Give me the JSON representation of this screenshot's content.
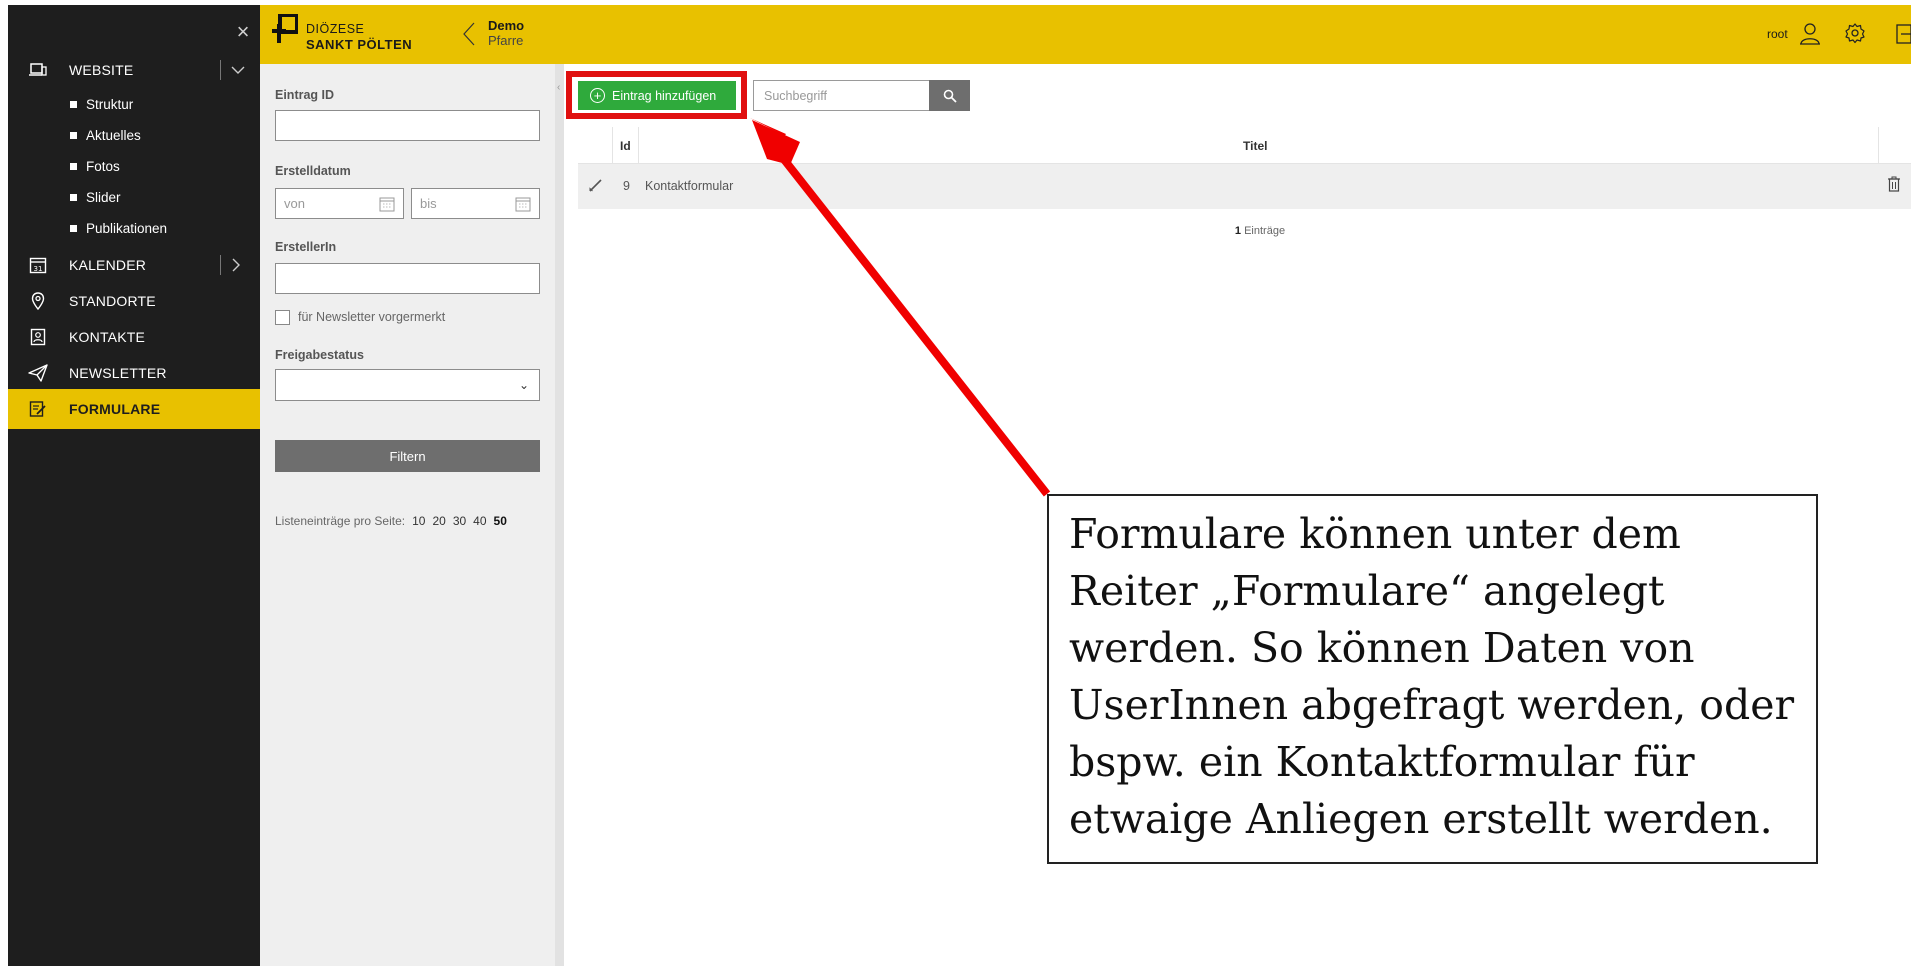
{
  "sidebar": {
    "close_label": "×",
    "items": [
      {
        "label": "WEBSITE",
        "icon": "laptop-icon",
        "has_toggle": true,
        "toggle": "chevron-down-icon"
      },
      {
        "label": "KALENDER",
        "icon": "calendar-icon",
        "has_toggle": true,
        "toggle": "chevron-right-icon"
      },
      {
        "label": "STANDORTE",
        "icon": "map-pin-icon"
      },
      {
        "label": "KONTAKTE",
        "icon": "contact-card-icon"
      },
      {
        "label": "NEWSLETTER",
        "icon": "paper-plane-icon"
      },
      {
        "label": "FORMULARE",
        "icon": "form-edit-icon",
        "active": true
      }
    ],
    "website_subitems": [
      "Struktur",
      "Aktuelles",
      "Fotos",
      "Slider",
      "Publikationen"
    ]
  },
  "header": {
    "logo_line1": "DIÖZESE",
    "logo_line2": "SANKT PÖLTEN",
    "site_name": "Demo",
    "site_sub": "Pfarre",
    "user_name": "root"
  },
  "filters": {
    "entry_id_label": "Eintrag ID",
    "entry_id_value": "",
    "created_label": "Erstelldatum",
    "from_placeholder": "von",
    "to_placeholder": "bis",
    "creator_label": "ErstellerIn",
    "creator_value": "",
    "newsletter_label": "für Newsletter vorgermerkt",
    "newsletter_checked": false,
    "status_label": "Freigabestatus",
    "status_value": "",
    "filter_button": "Filtern",
    "per_page_label": "Listeneinträge pro Seite:",
    "per_page_options": [
      "10",
      "20",
      "30",
      "40",
      "50"
    ],
    "per_page_selected": "50"
  },
  "toolbar": {
    "add_label": "Eintrag hinzufügen",
    "search_placeholder": "Suchbegriff"
  },
  "table": {
    "headers": {
      "id": "Id",
      "title": "Titel"
    },
    "rows": [
      {
        "id": "9",
        "title": "Kontaktformular"
      }
    ],
    "count_number": "1",
    "count_label": "Einträge"
  },
  "annotation": {
    "text": "Formulare können unter dem Reiter „Formulare“ angelegt werden. So können Daten von UserInnen abgefragt werden, oder bspw. ein Kontaktformular für etwaige Anliegen erstellt werden.",
    "highlight_color": "#e01010"
  },
  "colors": {
    "brand_yellow": "#e8c100",
    "sidebar_dark": "#1e1e1e",
    "add_green": "#2faa3c",
    "button_gray": "#6e6e6e"
  }
}
